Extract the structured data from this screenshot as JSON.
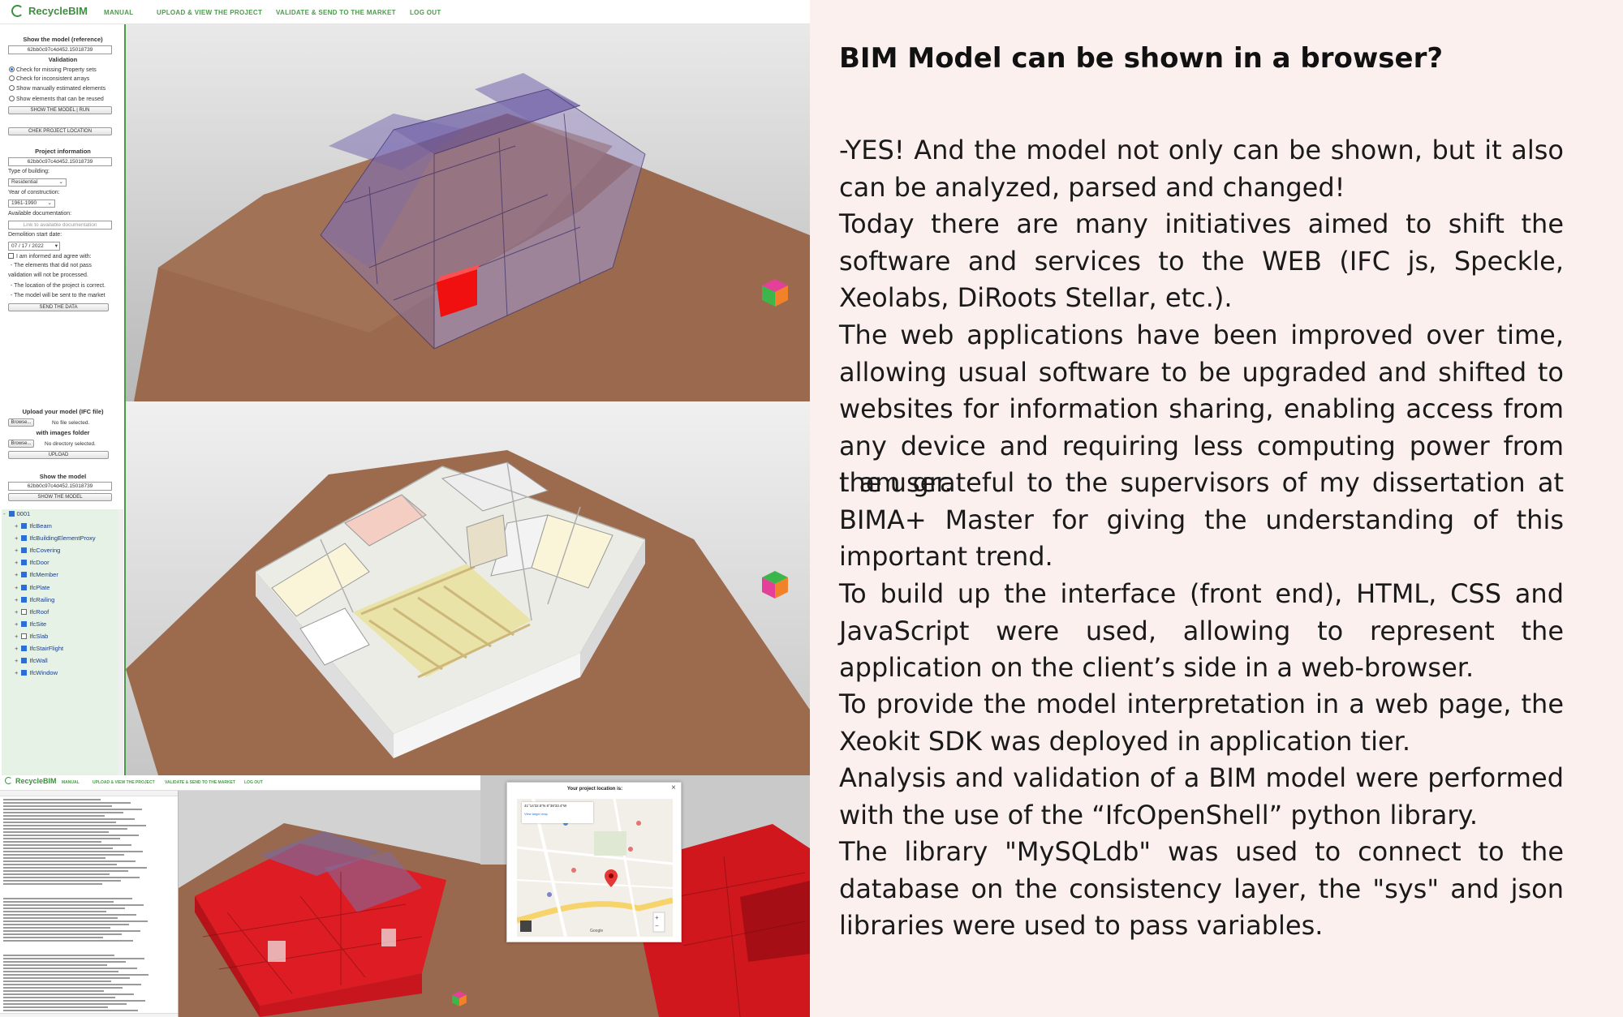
{
  "nav": {
    "brand": "RecycleBIM",
    "items": [
      "MANUAL",
      "UPLOAD & VIEW THE PROJECT",
      "VALIDATE & SEND TO THE MARKET",
      "LOG OUT"
    ]
  },
  "sidebar": {
    "show_model_ref_title": "Show the model (reference)",
    "model_id": "62bb0c97c4d452.15018739",
    "validation_title": "Validation",
    "validation_options": [
      {
        "label": "Check for missing Property sets",
        "checked": true
      },
      {
        "label": "Check for inconsistent arrays",
        "checked": false
      },
      {
        "label": "Show manually estimated elements",
        "checked": false
      },
      {
        "label": "Show elements that can be reused",
        "checked": false
      }
    ],
    "show_run_button": "SHOW THE MODEL | RUN",
    "check_location_button": "CHEK PROJECT LOCATION",
    "project_info_title": "Project information",
    "project_id": "62bb0c97c4d452.15018739",
    "type_label": "Type of building:",
    "type_value": "Residential",
    "year_label": "Year of construction:",
    "year_value": "1961-1990",
    "docs_label": "Available documentation:",
    "docs_placeholder": "Link to available documentation",
    "demolition_label": "Demolition start date:",
    "demolition_value": "07 / 17 / 2022",
    "agree_label": "I am informed and agree with:",
    "agree_items": [
      "- The elements that did not pass",
      "validation will not be processed.",
      "- The location of the project is correct.",
      "- The model will be sent to the market"
    ],
    "send_button": "SEND THE DATA",
    "upload_title": "Upload your model (IFC file)",
    "browse_label": "Browse...",
    "no_file": "No file selected.",
    "images_title": "with images folder",
    "no_dir": "No directory selected.",
    "upload_button": "UPLOAD",
    "show_model_title": "Show the model",
    "model_id2": "62bb0c97c4d452.15018739",
    "show_model_button": "SHOW THE MODEL"
  },
  "tree": {
    "root": "0001",
    "items": [
      {
        "label": "IfcBeam",
        "checked": true
      },
      {
        "label": "IfcBuildingElementProxy",
        "checked": true
      },
      {
        "label": "IfcCovering",
        "checked": true
      },
      {
        "label": "IfcDoor",
        "checked": true
      },
      {
        "label": "IfcMember",
        "checked": true
      },
      {
        "label": "IfcPlate",
        "checked": true
      },
      {
        "label": "IfcRailing",
        "checked": true
      },
      {
        "label": "IfcRoof",
        "checked": false
      },
      {
        "label": "IfcSite",
        "checked": true
      },
      {
        "label": "IfcSlab",
        "checked": false
      },
      {
        "label": "IfcStairFlight",
        "checked": true
      },
      {
        "label": "IfcWall",
        "checked": true
      },
      {
        "label": "IfcWindow",
        "checked": true
      }
    ]
  },
  "map_dialog": {
    "title": "Your project location is:",
    "coords": "41°14'32.5\"N 8°38'33.4\"W",
    "view_larger": "View larger map",
    "close": "×",
    "google": "Google"
  },
  "article": {
    "heading": "BIM Model can be shown in a browser?",
    "paragraphs": [
      "-YES! And the model not only can be shown, but it also can be analyzed, parsed and changed!",
      "Today there are many initiatives aimed to shift the software and services to the WEB (IFC js, Speckle, Xeolabs, DiRoots Stellar, etc.).",
      "The web applications have been improved over time, allowing usual software to be upgraded and shifted to websites for information sharing, enabling access from any device and requiring less computing power from the user.",
      "I am grateful to the supervisors of my dissertation at BIMA+ Master for giving the understanding of this important trend.",
      "To build up the interface (front end), HTML, CSS and JavaScript were used, allowing to represent the application on the client’s side in a web-browser.",
      "To provide the model interpretation in a web page, the Xeokit SDK was deployed in application tier.",
      "Analysis and validation of a BIM model were performed with the use of the “IfcOpenShell” python library.",
      "The library \"MySQLdb\" was used to connect to the database on the consistency layer, the \"sys\" and json libraries were used to pass variables."
    ]
  }
}
